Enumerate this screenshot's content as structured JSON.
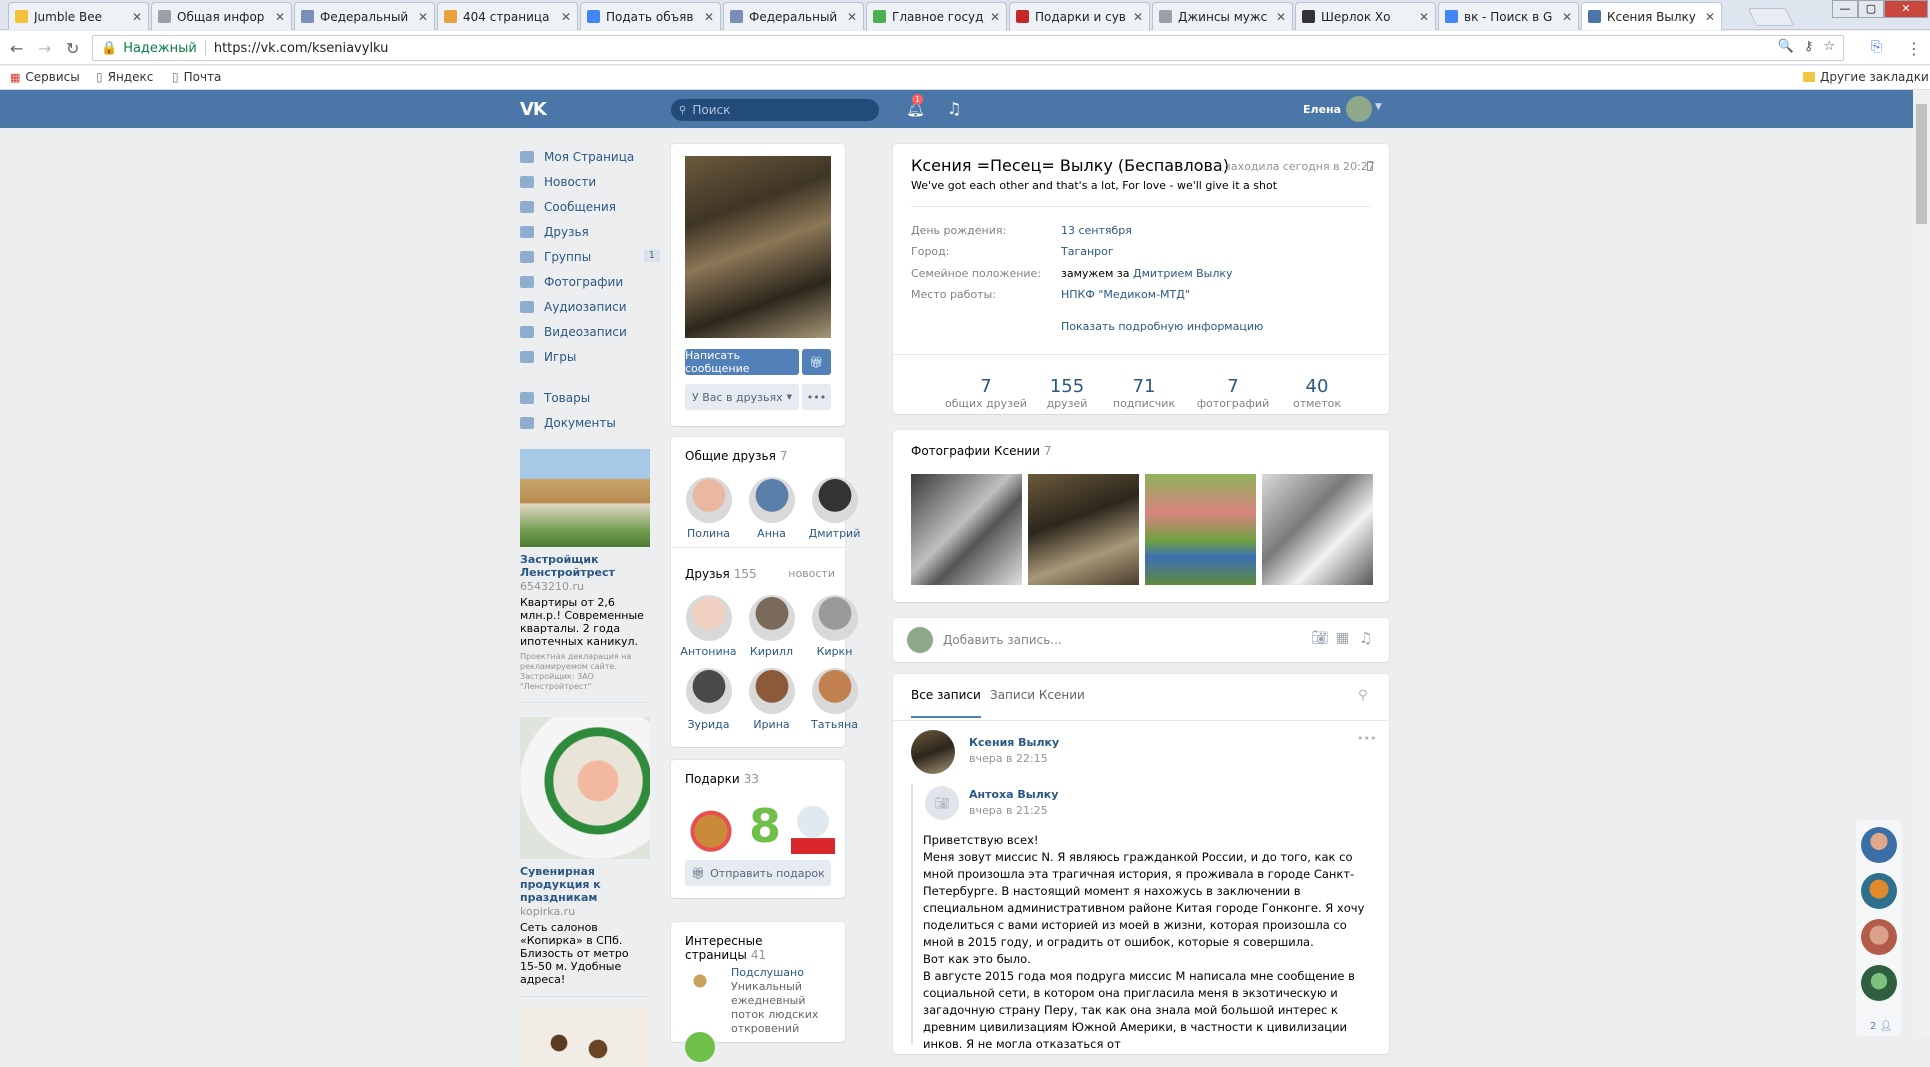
{
  "browser": {
    "tabs": [
      {
        "title": "Jumble Bee",
        "color": "#f3c13a"
      },
      {
        "title": "Общая инфор",
        "color": "#9aa0a6"
      },
      {
        "title": "Федеральный",
        "color": "#7a8fb8"
      },
      {
        "title": "404 страница",
        "color": "#e9a23b"
      },
      {
        "title": "Подать объяв",
        "color": "#4285f4"
      },
      {
        "title": "Федеральный",
        "color": "#7a8fb8"
      },
      {
        "title": "Главное госуд",
        "color": "#4caf50"
      },
      {
        "title": "Подарки и сув",
        "color": "#c62828"
      },
      {
        "title": "Джинсы мужс",
        "color": "#9aa0a6"
      },
      {
        "title": "Шерлок Хо",
        "color": "#333333"
      },
      {
        "title": "вк - Поиск в G",
        "color": "#4285f4"
      },
      {
        "title": "Ксения Вылку",
        "color": "#4a76a8",
        "active": true
      }
    ],
    "secure_label": "Надежный",
    "url": "https://vk.com/kseniavylku",
    "bookmarks": [
      "Сервисы",
      "Яндекс",
      "Почта"
    ],
    "other_bookmarks": "Другие закладки"
  },
  "vk_header": {
    "logo": "VK",
    "search_placeholder": "Поиск",
    "notifications_count": "1",
    "user_name": "Елена"
  },
  "left_nav": {
    "items": [
      {
        "label": "Моя Страница"
      },
      {
        "label": "Новости"
      },
      {
        "label": "Сообщения"
      },
      {
        "label": "Друзья"
      },
      {
        "label": "Группы",
        "count": "1"
      },
      {
        "label": "Фотографии"
      },
      {
        "label": "Аудиозаписи"
      },
      {
        "label": "Видеозаписи"
      },
      {
        "label": "Игры"
      }
    ],
    "items2": [
      {
        "label": "Товары"
      },
      {
        "label": "Документы"
      }
    ],
    "ads": [
      {
        "title": "Застройщик Ленстройтрест",
        "domain": "6543210.ru",
        "text": "Квартиры от 2,6 млн.р.! Современные кварталы. 2 года ипотечных каникул.",
        "small": "Проектная декларация на рекламируемом сайте. Застройщик: ЗАО \"Ленстройтрест\""
      },
      {
        "title": "Сувенирная продукция к праздникам",
        "domain": "kopirka.ru",
        "text": "Сеть салонов «Копирка» в СПб. Близость от метро 15-50 м. Удобные адреса!"
      }
    ]
  },
  "profile_left": {
    "write_message": "Написать сообщение",
    "friends_status": "У Вас в друзьях",
    "common_friends": {
      "title": "Общие друзья",
      "count": "7",
      "items": [
        "Полина",
        "Анна",
        "Дмитрий"
      ]
    },
    "friends": {
      "title": "Друзья",
      "count": "155",
      "news_link": "новости",
      "items": [
        "Антонина",
        "Кирилл",
        "Киркн",
        "Зурида",
        "Ирина",
        "Татьяна"
      ]
    },
    "gifts": {
      "title": "Подарки",
      "count": "33",
      "send": "Отправить подарок"
    },
    "pages": {
      "title": "Интересные страницы",
      "count": "41",
      "items": [
        {
          "name": "Подслушано",
          "desc": "Уникальный ежедневный поток людских откровений"
        }
      ]
    }
  },
  "profile": {
    "name": "Ксения =Песец= Вылку (Беспавлова)",
    "last_seen": "заходила сегодня в 20:27",
    "status": "We've got each other and that's a lot, For love - we'll give it a shot",
    "info": [
      {
        "key": "День рождения:",
        "value": "13 сентября"
      },
      {
        "key": "Город:",
        "value": "Таганрог"
      },
      {
        "key": "Семейное положение:",
        "value_prefix": "замужем за ",
        "value": "Дмитрием Вылку"
      },
      {
        "key": "Место работы:",
        "value": "НПКФ \"Медиком-МТД\""
      }
    ],
    "show_more": "Показать подробную информацию",
    "stats": [
      {
        "n": "7",
        "l": "общих друзей"
      },
      {
        "n": "155",
        "l": "друзей"
      },
      {
        "n": "71",
        "l": "подписчик"
      },
      {
        "n": "7",
        "l": "фотографий"
      },
      {
        "n": "40",
        "l": "отметок"
      }
    ],
    "photos_title": "Фотографии Ксении",
    "photos_count": "7"
  },
  "wall": {
    "add_post_placeholder": "Добавить запись...",
    "tab_all": "Все записи",
    "tab_own": "Записи Ксении",
    "post": {
      "author": "Ксения Вылку",
      "time": "вчера в 22:15",
      "repost_author": "Антоха Вылку",
      "repost_time": "вчера в 21:25",
      "paragraphs": [
        "Приветствую всех!",
        "Меня зовут миссис N. Я являюсь гражданкой России, и до того, как со мной произошла эта трагичная история, я проживала в городе Санкт-Петербурге. В настоящий момент я нахожусь в заключении в специальном административном районе Китая городе Гонконге. Я хочу поделиться с вами историей из моей в жизни, которая произошла со мной в 2015 году, и оградить от ошибок, которые я совершила.",
        "Вот как это было.",
        "В августе 2015 года моя подруга миссис М написала мне сообщение в социальной сети, в котором она пригласила меня в экзотическую и загадочную страну Перу, так как она знала мой большой интерес к древним цивилизациям Южной Америки, в частности к цивилизации инков. Я не могла отказаться от"
      ]
    }
  },
  "float": {
    "count": "2"
  }
}
